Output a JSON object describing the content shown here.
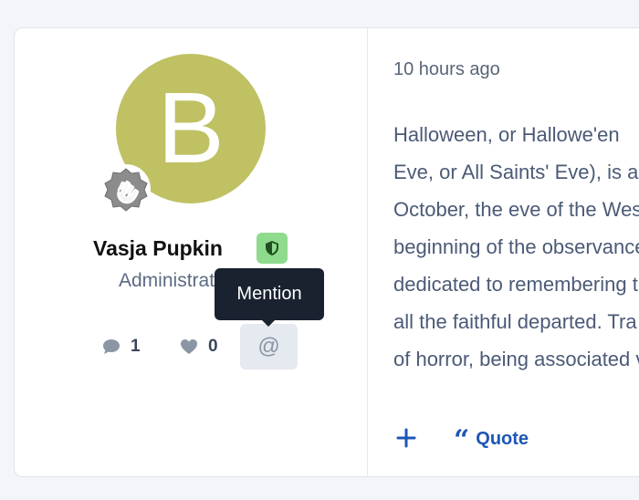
{
  "colors": {
    "page_background": "#f3f5f8",
    "card_background": "#ffffff",
    "avatar_background": "#bfc163",
    "staff_badge_background": "#8fdb8d",
    "staff_badge_icon": "#1f4f1f",
    "tooltip_background": "#1a2230",
    "link_blue": "#1d56b4",
    "body_text": "#4b5a76",
    "muted_icon": "#8b96a5"
  },
  "user": {
    "avatar_letter": "B",
    "name": "Vasja Pupkin",
    "title": "Administrator",
    "rank_icon": "waving-hand-badge-icon",
    "staff_icon": "shield-icon",
    "stats": {
      "messages": "1",
      "reactions": "0",
      "message_icon": "speech-bubble-icon",
      "reaction_icon": "heart-icon"
    }
  },
  "tooltip": {
    "text": "Mention"
  },
  "mention_button": {
    "icon": "at-sign-icon",
    "glyph": "@"
  },
  "post": {
    "time": "10 hours ago",
    "body_lines": [
      "Halloween, or Hallowe'en",
      "Eve, or All Saints' Eve), is a",
      "October, the eve of the Wes",
      "beginning of the observance",
      "dedicated to remembering th",
      "all the faithful departed. Tra",
      "of horror, being associated v"
    ]
  },
  "actions": {
    "plus_icon": "plus-icon",
    "quote_icon": "quote-icon",
    "quote_glyph": "“",
    "quote_label": "Quote"
  }
}
